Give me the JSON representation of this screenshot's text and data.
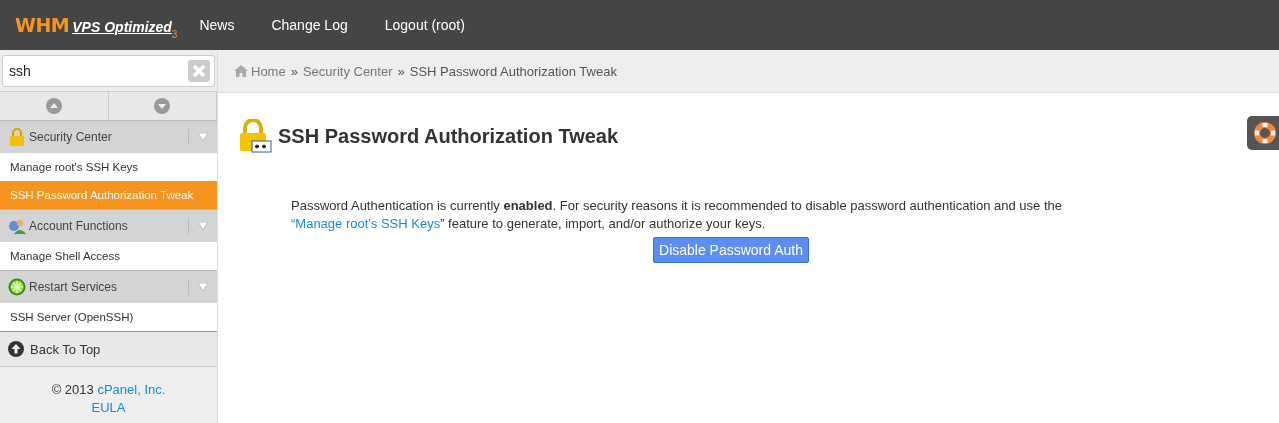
{
  "header": {
    "logo": {
      "brand": "WHM",
      "product": "VPS Optimized",
      "version": "3"
    },
    "nav": [
      "News",
      "Change Log",
      "Logout (root)"
    ]
  },
  "sidebar": {
    "search": {
      "value": "ssh"
    },
    "groups": [
      {
        "title": "Security Center",
        "kind": "lock",
        "items": [
          {
            "label": "Manage root's SSH Keys",
            "selected": false
          },
          {
            "label": "SSH Password Authorization Tweak",
            "selected": true
          }
        ]
      },
      {
        "title": "Account Functions",
        "kind": "users",
        "items": [
          {
            "label": "Manage Shell Access",
            "selected": false
          }
        ]
      },
      {
        "title": "Restart Services",
        "kind": "wheel",
        "items": [
          {
            "label": "SSH Server (OpenSSH)",
            "selected": false
          }
        ]
      }
    ],
    "back_to_top": "Back To Top",
    "footer": {
      "copyright": "© 2013",
      "company": "cPanel, Inc.",
      "eula": "EULA"
    }
  },
  "breadcrumb": {
    "separator": "»",
    "items": [
      "Home",
      "Security Center",
      "SSH Password Authorization Tweak"
    ]
  },
  "page": {
    "title": "SSH Password Authorization Tweak",
    "message": {
      "before": "Password Authentication is currently **enabled**. For security reasons it is recommended to disable password authentication and use the ",
      "link": "“Manage root's SSH Keys",
      "after": "” feature to generate, import, and/or authorize your keys."
    },
    "button": "Disable Password Auth"
  }
}
